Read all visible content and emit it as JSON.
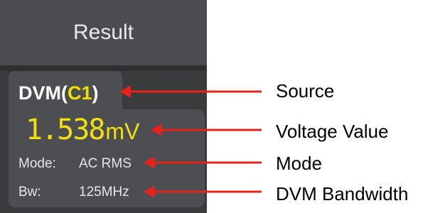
{
  "panel": {
    "title": "Result",
    "dvm_prefix": "DVM(",
    "dvm_source": "C1",
    "dvm_suffix": ")",
    "reading_value": "1.538",
    "reading_unit": "mV",
    "mode_label": "Mode:",
    "mode_value": "AC RMS",
    "bw_label": "Bw:",
    "bw_value": "125MHz"
  },
  "callouts": {
    "source": "Source",
    "voltage": "Voltage Value",
    "mode": "Mode",
    "bandwidth": "DVM Bandwidth"
  },
  "colors": {
    "panel_bg": "#3a3b3d",
    "header_bg": "#4b4c4f",
    "card_bg": "#4d4e51",
    "channel_yellow": "#f0e000",
    "arrow_red": "#e8211b"
  }
}
